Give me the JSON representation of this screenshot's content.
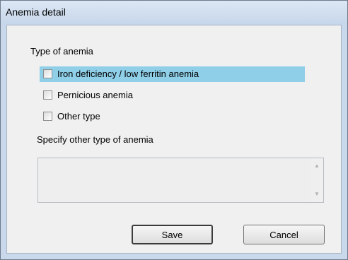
{
  "window": {
    "title": "Anemia detail"
  },
  "type_section": {
    "label": "Type of anemia",
    "options": [
      {
        "label": "Iron deficiency / low ferritin anemia",
        "checked": false,
        "selected": true
      },
      {
        "label": "Pernicious anemia",
        "checked": false,
        "selected": false
      },
      {
        "label": "Other type",
        "checked": false,
        "selected": false
      }
    ]
  },
  "specify": {
    "label": "Specify other type of anemia",
    "value": ""
  },
  "buttons": {
    "save": "Save",
    "cancel": "Cancel"
  },
  "colors": {
    "selection_highlight": "#8fcfe8",
    "frame": "#c9d8ea",
    "client_background": "#f0f0f0"
  }
}
